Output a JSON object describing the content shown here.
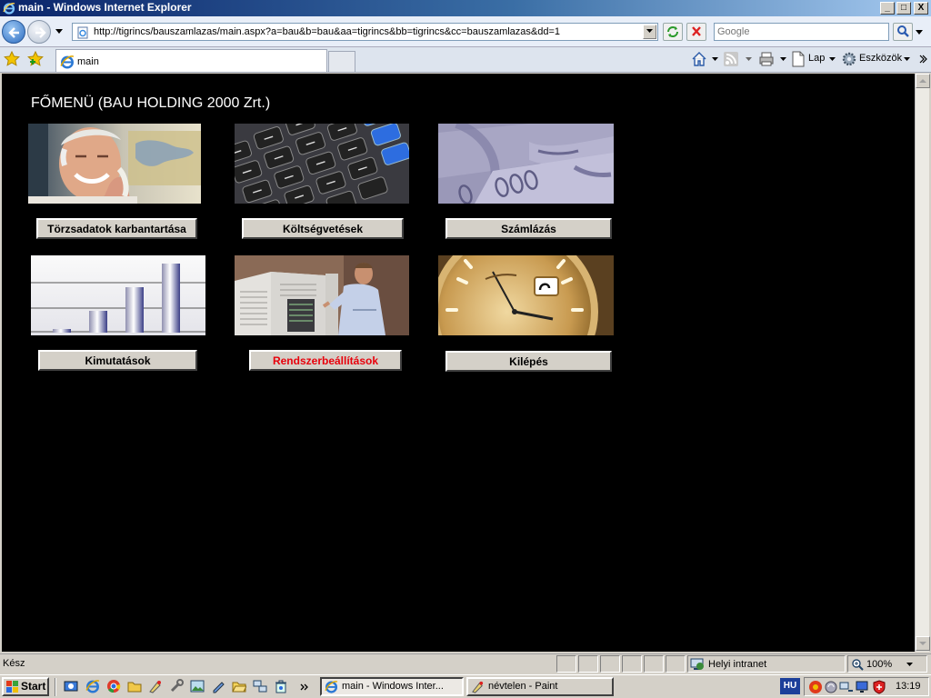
{
  "window": {
    "title": "main - Windows Internet Explorer",
    "minimize": "_",
    "maximize": "□",
    "close": "X"
  },
  "navbar": {
    "url": "http://tigrincs/bauszamlazas/main.aspx?a=bau&b=bau&aa=tigrincs&bb=tigrincs&cc=bauszamlazas&dd=1",
    "search_placeholder": "Google"
  },
  "tabs": {
    "active": "main"
  },
  "commands": {
    "page": "Lap",
    "tools": "Eszközök"
  },
  "page": {
    "title": "FŐMENÜ (BAU HOLDING 2000 Zrt.)",
    "menu": [
      {
        "label": "Törzsadatok karbantartása",
        "image": "person-phone-photo",
        "active": false
      },
      {
        "label": "Költségvetések",
        "image": "calculator-keys-photo",
        "active": false
      },
      {
        "label": "Számlázás",
        "image": "banknotes-photo",
        "active": false
      },
      {
        "label": "Kimutatások",
        "image": "bar-chart-picture",
        "active": false
      },
      {
        "label": "Rendszerbeállítások",
        "image": "server-technician-photo",
        "active": true
      },
      {
        "label": "Kilépés",
        "image": "wristwatch-photo",
        "active": false
      }
    ]
  },
  "statusbar": {
    "status": "Kész",
    "zone": "Helyi intranet",
    "zoom": "100%"
  },
  "taskbar": {
    "start": "Start",
    "buttons": [
      "main - Windows Inter...",
      "névtelen - Paint"
    ],
    "language": "HU",
    "clock": "13:19"
  },
  "colors": {
    "active_label": "#e8000b",
    "page_background": "#000000",
    "title_bar_start": "#0a246a"
  }
}
